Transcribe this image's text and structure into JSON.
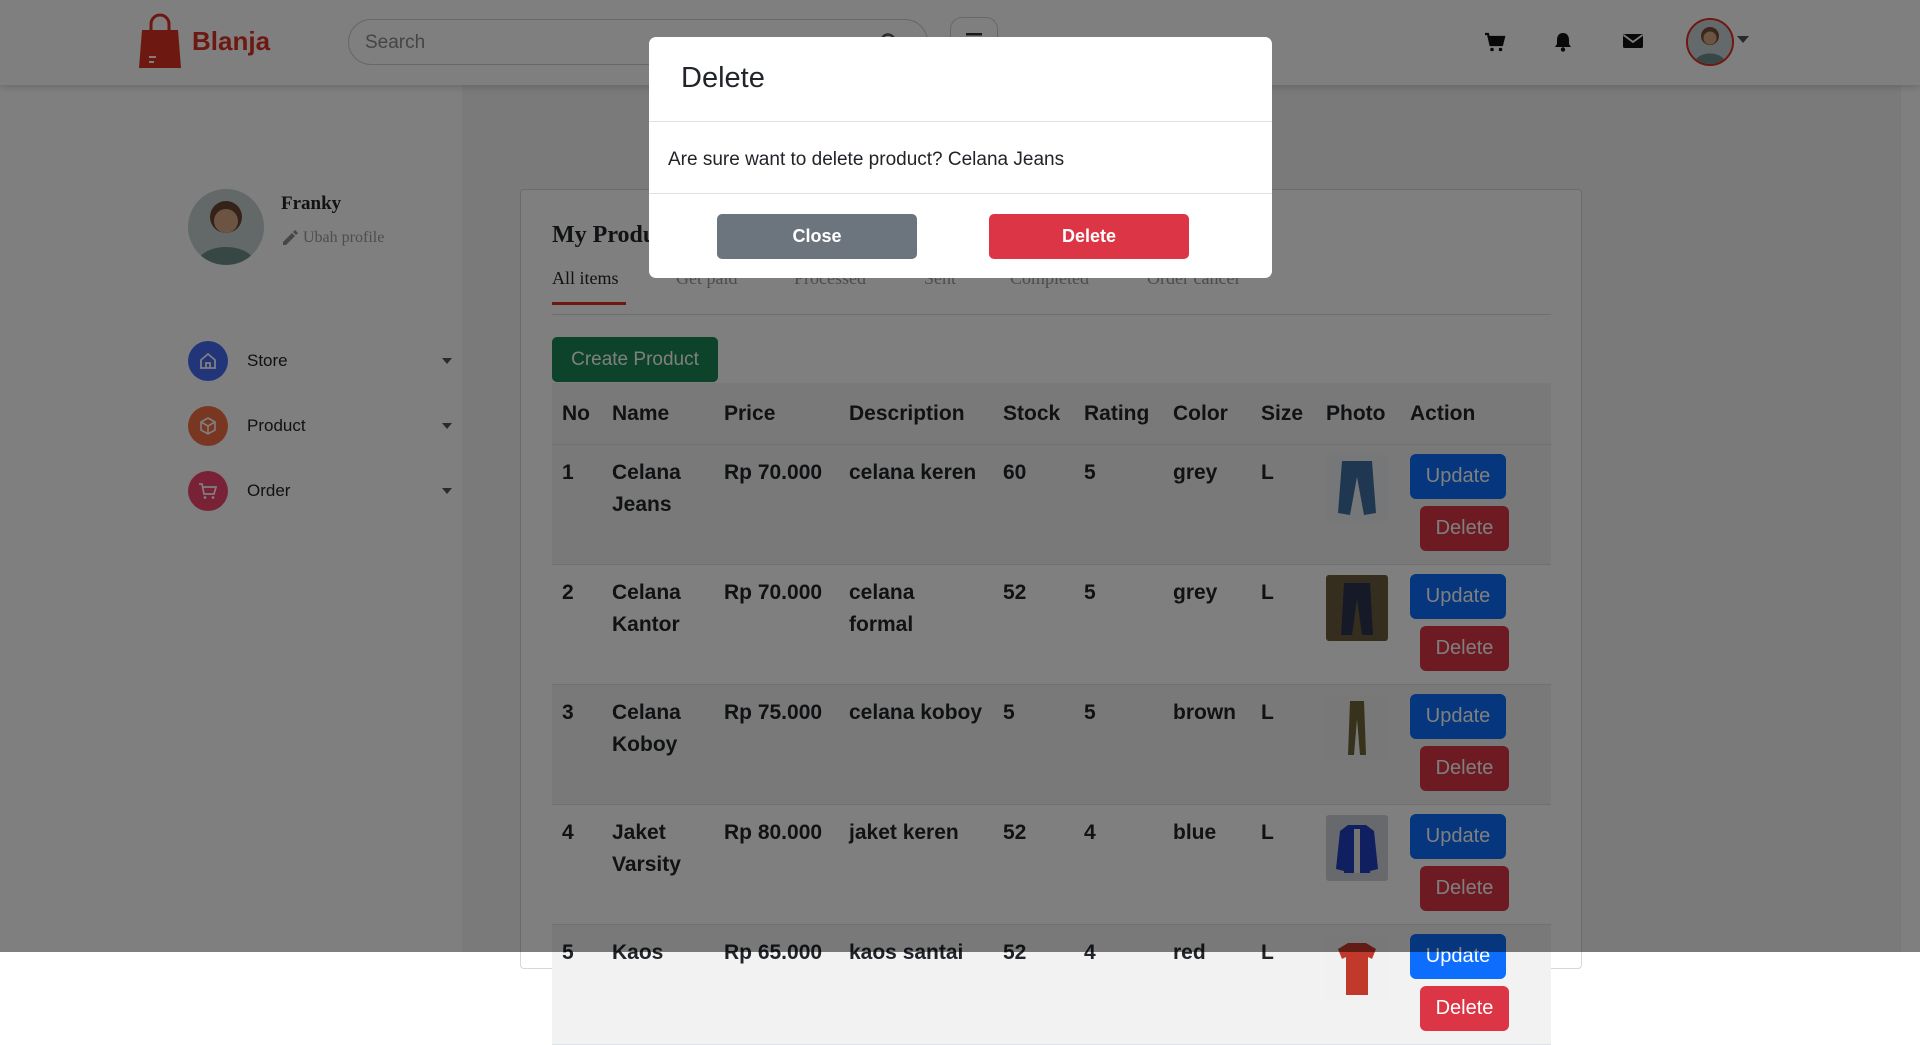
{
  "brand": {
    "name": "Blanja",
    "color": "#db3022"
  },
  "search": {
    "placeholder": "Search",
    "icon": "search-icon"
  },
  "nav_icons": [
    "cart-icon",
    "bell-icon",
    "mail-icon"
  ],
  "profile": {
    "name": "Franky",
    "edit_label": "Ubah profile"
  },
  "sidebar": {
    "items": [
      {
        "label": "Store",
        "icon": "home-icon",
        "color": "#456bf3"
      },
      {
        "label": "Product",
        "icon": "box-icon",
        "color": "#f36f45"
      },
      {
        "label": "Order",
        "icon": "cart-icon",
        "color": "#f3456f"
      }
    ]
  },
  "main": {
    "title": "My Product",
    "tabs": [
      "All items",
      "Get paid",
      "Processed",
      "Sent",
      "Completed",
      "Order cancel"
    ],
    "create_label": "Create Product",
    "columns": [
      "No",
      "Name",
      "Price",
      "Description",
      "Stock",
      "Rating",
      "Color",
      "Size",
      "Photo",
      "Action"
    ],
    "rows": [
      {
        "no": "1",
        "name": "Celana Jeans",
        "price": "Rp 70.000",
        "description": "celana keren",
        "stock": "60",
        "rating": "5",
        "color": "grey",
        "size": "L"
      },
      {
        "no": "2",
        "name": "Celana Kantor",
        "price": "Rp 70.000",
        "description": "celana formal",
        "stock": "52",
        "rating": "5",
        "color": "grey",
        "size": "L"
      },
      {
        "no": "3",
        "name": "Celana Koboy",
        "price": "Rp 75.000",
        "description": "celana koboy",
        "stock": "5",
        "rating": "5",
        "color": "brown",
        "size": "L"
      },
      {
        "no": "4",
        "name": "Jaket Varsity",
        "price": "Rp 80.000",
        "description": "jaket keren",
        "stock": "52",
        "rating": "4",
        "color": "blue",
        "size": "L"
      },
      {
        "no": "5",
        "name": "Kaos",
        "price": "Rp 65.000",
        "description": "kaos santai",
        "stock": "52",
        "rating": "4",
        "color": "red",
        "size": "L"
      }
    ],
    "update_label": "Update",
    "delete_label": "Delete"
  },
  "modal": {
    "title": "Delete",
    "message": "Are sure want to delete product? Celana Jeans",
    "close_label": "Close",
    "delete_label": "Delete"
  }
}
